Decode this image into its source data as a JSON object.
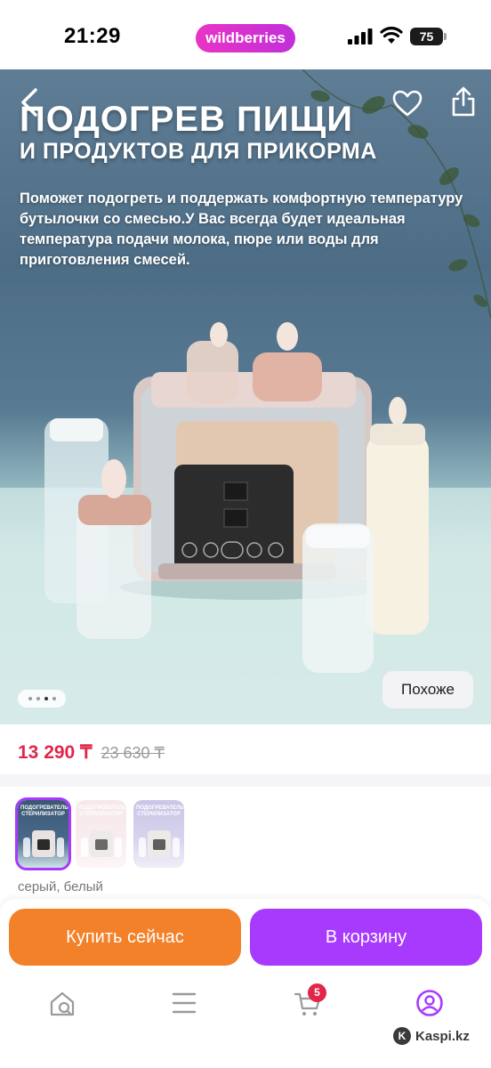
{
  "status_bar": {
    "time": "21:29",
    "app_logo": "wildberries",
    "battery": "75",
    "icons": [
      "signal-icon",
      "wifi-icon",
      "battery-icon"
    ]
  },
  "hero": {
    "title_line_1": "ПОДОГРЕВ ПИЩИ",
    "title_line_2": "И ПРОДУКТОВ ДЛЯ ПРИКОРМА",
    "description": "Поможет подогреть и поддержать комфортную температуру бутылочки со смесью.У Вас всегда будет идеальная температура подачи молока, пюре или воды для приготовления смесей.",
    "similar_label": "Похоже",
    "carousel": {
      "total_dots": 4,
      "active_index": 2
    },
    "icons": [
      "back-icon",
      "heart-icon",
      "share-icon"
    ]
  },
  "price": {
    "current": "13 290 ₸",
    "old": "23 630 ₸"
  },
  "variants": {
    "items": [
      {
        "caption": "ПОДОГРЕВАТЕЛЬ СТЕРИЛИЗАТОР",
        "selected": true
      },
      {
        "caption": "ПОДОГРЕВАТЕЛЬ СТЕРИЛИЗАТОР",
        "selected": false
      },
      {
        "caption": "ПОДОГРЕВАТЕЛЬ СТЕРИЛИЗАТОР",
        "selected": false
      }
    ],
    "color_label": "серый, белый"
  },
  "actions": {
    "buy_now": "Купить сейчас",
    "add_to_cart": "В корзину"
  },
  "bottom_nav": {
    "items": [
      "home-search-icon",
      "catalog-menu-icon",
      "cart-icon",
      "profile-icon"
    ],
    "cart_count": "5",
    "active": "profile-icon"
  },
  "watermark": {
    "logo": "K",
    "text": "Kaspi.kz"
  },
  "colors": {
    "brand_purple": "#a73afd",
    "buy_orange": "#f3812a",
    "price_red": "#e0274b",
    "wb_gradient_start": "#e934c5",
    "wb_gradient_end": "#c22fd9"
  }
}
